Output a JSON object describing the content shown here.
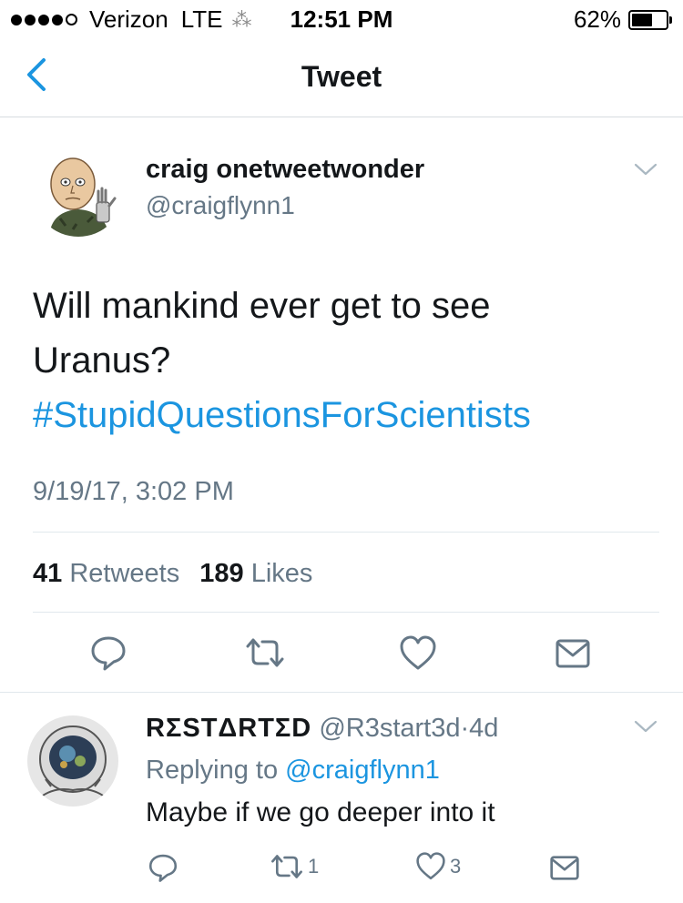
{
  "status_bar": {
    "carrier": "Verizon",
    "network": "LTE",
    "time": "12:51 PM",
    "battery_percent": "62%",
    "battery_level": 0.62,
    "signal_bars": 4
  },
  "nav": {
    "title": "Tweet"
  },
  "tweet": {
    "author_name": "craig onetweetwonder",
    "author_handle": "@craigflynn1",
    "text_line1": "Will mankind ever get to see",
    "text_line2": "Uranus?",
    "hashtag": "#StupidQuestionsForScientists",
    "timestamp": "9/19/17, 3:02 PM",
    "retweet_count": "41",
    "retweet_label": "Retweets",
    "like_count": "189",
    "like_label": "Likes"
  },
  "reply": {
    "author_name": "RΣSTΔRTΣD",
    "author_handle": "@R3start3d",
    "separator": "·",
    "age": "4d",
    "replying_prefix": "Replying to",
    "replying_handle": "@craigflynn1",
    "text": "Maybe if we go deeper into it",
    "retweet_count": "1",
    "like_count": "3"
  },
  "icons": {
    "back": "chevron-left-icon",
    "caret": "chevron-down-icon",
    "reply": "reply-icon",
    "retweet": "retweet-icon",
    "like": "heart-icon",
    "dm": "envelope-icon"
  },
  "colors": {
    "accent": "#1b95e0",
    "secondary_text": "#657786",
    "divider": "#e1e8ed"
  }
}
